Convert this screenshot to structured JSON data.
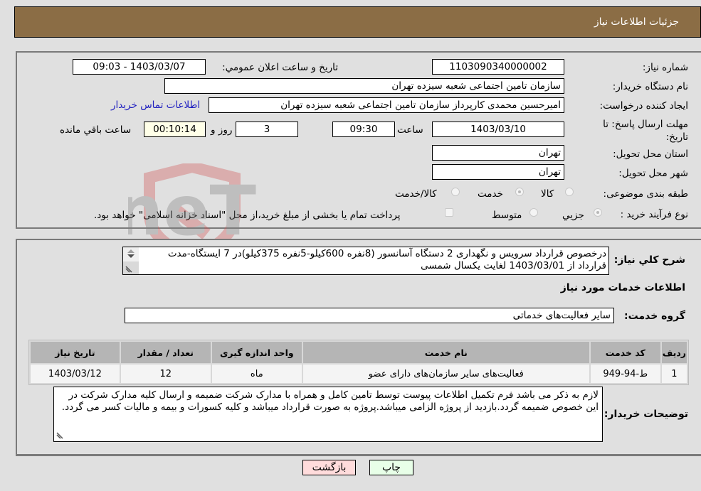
{
  "header": {
    "title": "جزئیات اطلاعات نیاز"
  },
  "form": {
    "need_number": {
      "label": "شماره نیاز:",
      "value": "1103090340000002"
    },
    "announce_datetime": {
      "label": "تاریخ و ساعت اعلان عمومي:",
      "value": "1403/03/07 - 09:03"
    },
    "buyer_org": {
      "label": "نام دستگاه خریدار:",
      "value": "سازمان تامین اجتماعی شعبه سیزده تهران"
    },
    "requester": {
      "label": "ایجاد کننده درخواست:",
      "value": "امیرحسین محمدی کارپرداز سازمان تامین اجتماعی شعبه سیزده تهران",
      "contact_link": "اطلاعات تماس خریدار"
    },
    "deadline": {
      "label": "مهلت ارسال پاسخ: تا تاریخ:",
      "date": "1403/03/10",
      "time_label": "ساعت",
      "time": "09:30",
      "days": "3",
      "days_label": "روز و",
      "remaining": "00:10:14",
      "remaining_label": "ساعت باقي مانده"
    },
    "province": {
      "label": "استان محل تحویل:",
      "value": "تهران"
    },
    "city": {
      "label": "شهر محل تحویل:",
      "value": "تهران"
    },
    "category": {
      "label": "طبقه بندی موضوعی:",
      "options": [
        "کالا",
        "خدمت",
        "کالا/خدمت"
      ],
      "selected": "خدمت"
    },
    "purchase_type": {
      "label": "نوع فرآیند خرید :",
      "options": [
        "جزيي",
        "متوسط"
      ],
      "selected": "جزيي",
      "treasury_checkbox_label": "پرداخت تمام یا بخشی از مبلغ خرید،از محل \"اسناد خزانه اسلامی\" خواهد بود."
    }
  },
  "description": {
    "label": "شرح کلي نیاز:",
    "value": "درخصوص قرارداد سرویس و نگهداری 2 دستگاه آسانسور (8نفره 600کیلو-5نفره 375کیلو)در 7 ایستگاه-مدت قرارداد از 1403/03/01 لغایت یکسال شمسی"
  },
  "services": {
    "section_title": "اطلاعات خدمات مورد نیاز",
    "group_label": "گروه خدمت:",
    "group_value": "سایر فعالیت‌های خدماتی",
    "table": {
      "headers": [
        "ردیف",
        "کد خدمت",
        "نام خدمت",
        "واحد اندازه گیری",
        "تعداد / مقدار",
        "تاریخ نیاز"
      ],
      "rows": [
        [
          "1",
          "ط-94-949",
          "فعالیت‌های سایر سازمان‌های دارای عضو",
          "ماه",
          "12",
          "1403/03/12"
        ]
      ]
    }
  },
  "buyer_notes": {
    "label": "توضیحات خریدار:",
    "value": "لازم به ذکر می باشد فرم تکمیل اطلاعات پیوست توسط تامین کامل و همراه با مدارک شرکت ضمیمه و ارسال کلیه مدارک شرکت در این خصوص ضمیمه گردد.بازدید از پروژه الزامی میباشد.پروژه به صورت قرارداد میباشد و کلیه کسورات و بیمه و مالیات کسر می گردد."
  },
  "buttons": {
    "print": "چاپ",
    "back": "بازگشت"
  },
  "watermark": {
    "text": "AriaTender.neT"
  }
}
